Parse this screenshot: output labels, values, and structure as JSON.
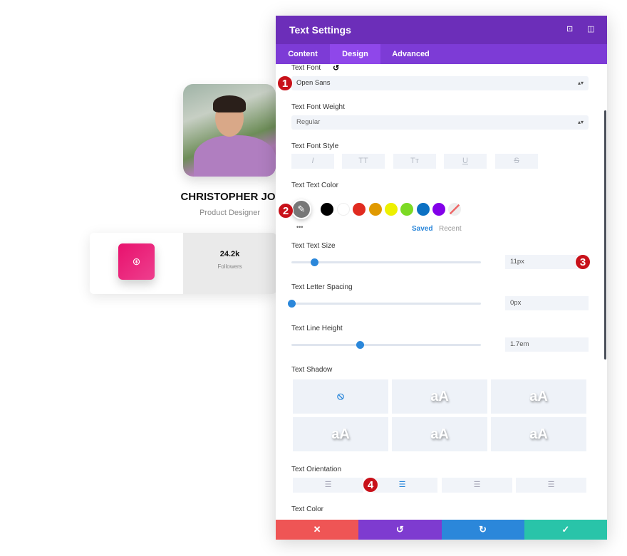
{
  "profile": {
    "name": "CHRISTOPHER JOE",
    "role": "Product Designer",
    "followers_count": "24.2k",
    "followers_label": "Followers",
    "social_icon": "dribbble-icon",
    "social_color": "#e8116d"
  },
  "panel": {
    "title": "Text Settings",
    "header_icons": [
      "focus-icon",
      "sidebar-toggle-icon"
    ],
    "tabs": [
      {
        "label": "Content"
      },
      {
        "label": "Design",
        "active": true
      },
      {
        "label": "Advanced"
      }
    ],
    "text_font": {
      "label": "Text Font",
      "value": "Open Sans"
    },
    "font_weight": {
      "label": "Text Font Weight",
      "value": "Regular"
    },
    "font_style": {
      "label": "Text Font Style",
      "buttons": [
        "I",
        "TT",
        "Tт",
        "U",
        "S"
      ]
    },
    "text_color": {
      "label": "Text Text Color",
      "swatches": [
        "#000000",
        "#ffffff",
        "#e02b20",
        "#e09900",
        "#edf000",
        "#7cda24",
        "#0c71c3",
        "#8300e9"
      ],
      "saved": "Saved",
      "recent": "Recent",
      "more": "•••"
    },
    "text_size": {
      "label": "Text Text Size",
      "value": "11px",
      "slider_percent": 12
    },
    "letter_spacing": {
      "label": "Text Letter Spacing",
      "value": "0px",
      "slider_percent": 0
    },
    "line_height": {
      "label": "Text Line Height",
      "value": "1.7em",
      "slider_percent": 36
    },
    "text_shadow": {
      "label": "Text Shadow",
      "preview": "aA",
      "selected": "none"
    },
    "orientation": {
      "label": "Text Orientation",
      "options": [
        "left",
        "center",
        "right",
        "justify"
      ],
      "selected": "center"
    },
    "text_color2": {
      "label": "Text Color"
    },
    "footer": {
      "colors": [
        "#ef5555",
        "#7e3bd0",
        "#2b87da",
        "#29c4a9"
      ]
    },
    "markers": [
      "1",
      "2",
      "3",
      "4"
    ],
    "accent": "#6c2eb9"
  }
}
